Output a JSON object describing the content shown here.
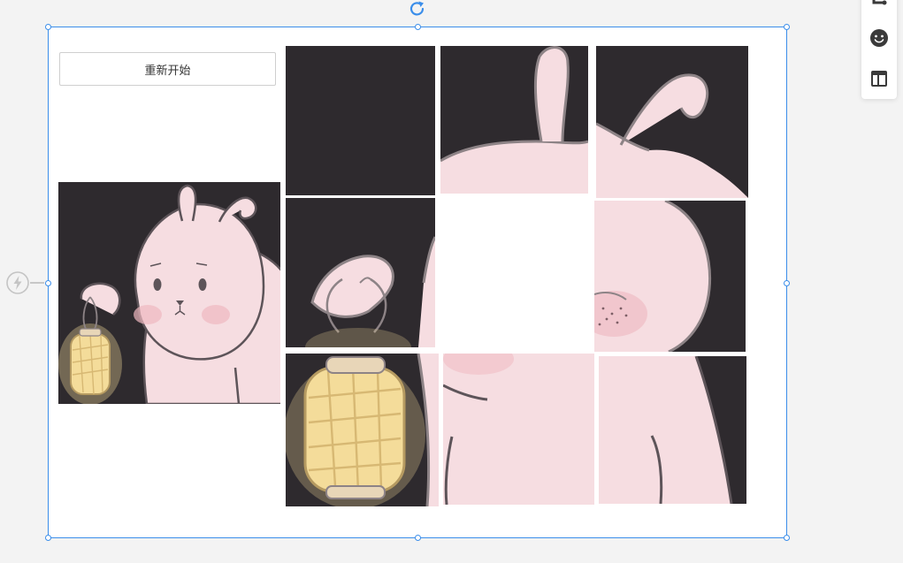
{
  "game": {
    "restart_label": "重新开始",
    "preview_image": "bunny-with-lantern-illustration",
    "puzzle_grid": [
      3,
      3
    ],
    "tiles": [
      {
        "position": 1,
        "piece": "dark-corner"
      },
      {
        "position": 2,
        "piece": "bunny-left-ear"
      },
      {
        "position": 3,
        "piece": "bunny-right-ear"
      },
      {
        "position": 4,
        "piece": "paw-holding-lantern"
      },
      {
        "position": 5,
        "piece": "empty"
      },
      {
        "position": 6,
        "piece": "cheek-with-blush"
      },
      {
        "position": 7,
        "piece": "glowing-lantern"
      },
      {
        "position": 8,
        "piece": "bunny-belly"
      },
      {
        "position": 9,
        "piece": "bunny-side"
      }
    ]
  },
  "editor": {
    "selection_color": "#3b8eea",
    "icons": [
      "rotate-icon",
      "action-lightning-icon"
    ]
  },
  "toolbar": {
    "icons": [
      "crop-icon",
      "emoji-icon",
      "layout-icon"
    ]
  },
  "colors": {
    "background": "#f3f3f3",
    "canvas": "#ffffff",
    "dark_bg": "#2e2a2e",
    "bunny_pink": "#f6dde1",
    "blush": "#efb8c0",
    "outline": "#5d5459",
    "lantern": "#f4dc9a"
  }
}
